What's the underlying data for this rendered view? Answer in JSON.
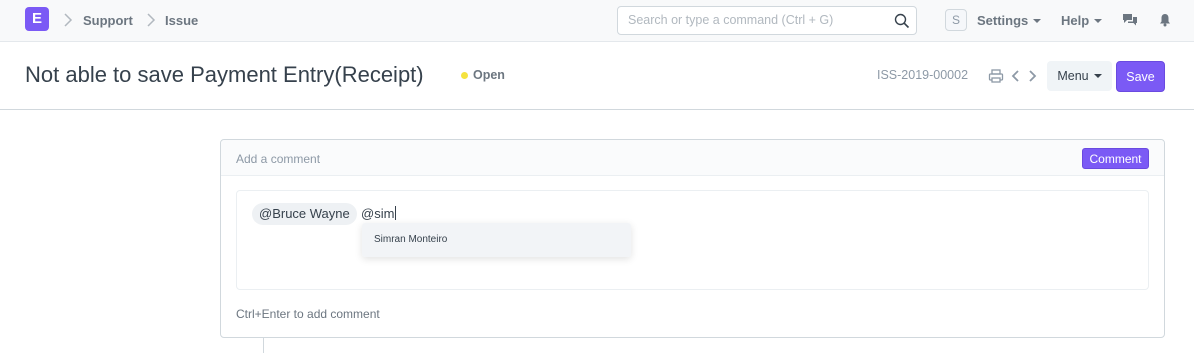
{
  "app": {
    "logo_letter": "E"
  },
  "breadcrumbs": [
    "Support",
    "Issue"
  ],
  "search": {
    "placeholder": "Search or type a command (Ctrl + G)"
  },
  "navbar": {
    "avatar_initial": "S",
    "settings_label": "Settings",
    "help_label": "Help"
  },
  "page": {
    "title": "Not able to save Payment Entry(Receipt)",
    "status": "Open",
    "doc_name": "ISS-2019-00002",
    "menu_label": "Menu",
    "save_label": "Save"
  },
  "comment": {
    "header_label": "Add a comment",
    "button_label": "Comment",
    "mention_tag": "@Bruce Wayne",
    "typed_text": "@sim",
    "suggestions": [
      "Simran Monteiro"
    ],
    "hint": "Ctrl+Enter to add comment"
  },
  "colors": {
    "accent": "#7b5af5",
    "status_open": "#f5e33f"
  }
}
